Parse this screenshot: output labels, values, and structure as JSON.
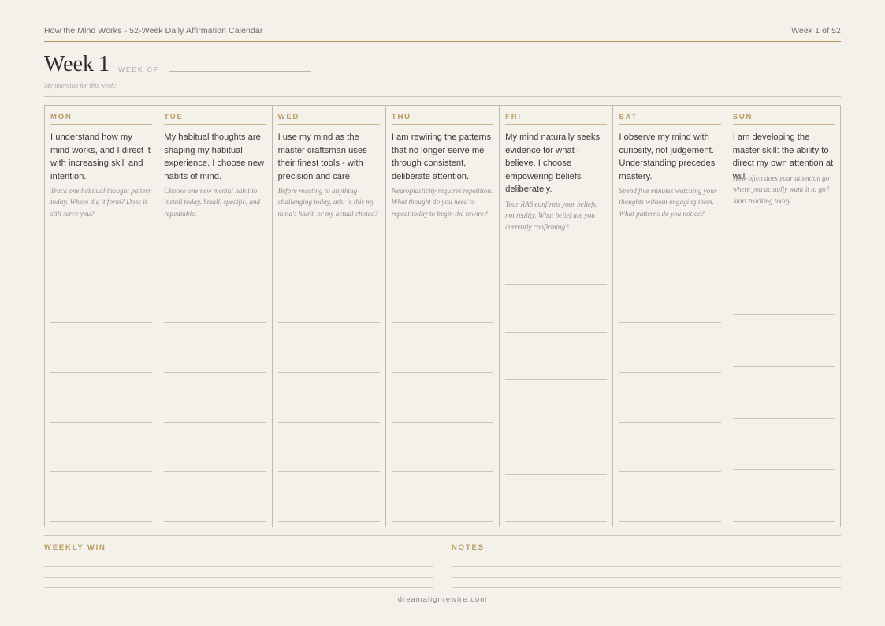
{
  "header": {
    "doc_title": "How the Mind Works - 52-Week Daily Affirmation Calendar",
    "week_counter": "Week 1 of 52"
  },
  "week": {
    "title": "Week",
    "number": "1",
    "week_of_label": "WEEK OF",
    "intention_label": "My intention for this week:"
  },
  "days": [
    {
      "label": "MON",
      "affirmation": "I understand how my mind works, and I direct it with increasing skill and intention.",
      "prompt": "Track one habitual thought pattern today. Where did it form? Does it still serve you?"
    },
    {
      "label": "TUE",
      "affirmation": "My habitual thoughts are shaping my habitual experience. I choose new habits of mind.",
      "prompt": "Choose one new mental habit to install today. Small, specific, and repeatable."
    },
    {
      "label": "WED",
      "affirmation": "I use my mind as the master craftsman uses their finest tools - with precision and care.",
      "prompt": "Before reacting to anything challenging today, ask: is this my mind's habit, or my actual choice?"
    },
    {
      "label": "THU",
      "affirmation": "I am rewiring the patterns that no longer serve me through consistent, deliberate attention.",
      "prompt": "Neuroplasticity requires repetition. What thought do you need to repeat today to begin the rewire?"
    },
    {
      "label": "FRI",
      "affirmation": "My mind naturally seeks evidence for what I believe. I choose empowering beliefs deliberately.",
      "prompt": "Your RAS confirms your beliefs, not reality. What belief are you currently confirming?"
    },
    {
      "label": "SAT",
      "affirmation": "I observe my mind with curiosity, not judgement. Understanding precedes mastery.",
      "prompt": "Spend five minutes watching your thoughts without engaging them. What patterns do you notice?"
    },
    {
      "label": "SUN",
      "affirmation": "I am developing the master skill: the ability to direct my own attention at will.",
      "prompt": "How often does your attention go where you actually want it to go? Start tracking today."
    }
  ],
  "bottom": {
    "weekly_win_label": "WEEKLY WIN",
    "notes_label": "NOTES"
  },
  "footer": {
    "url": "dreamalignrewire.com"
  }
}
